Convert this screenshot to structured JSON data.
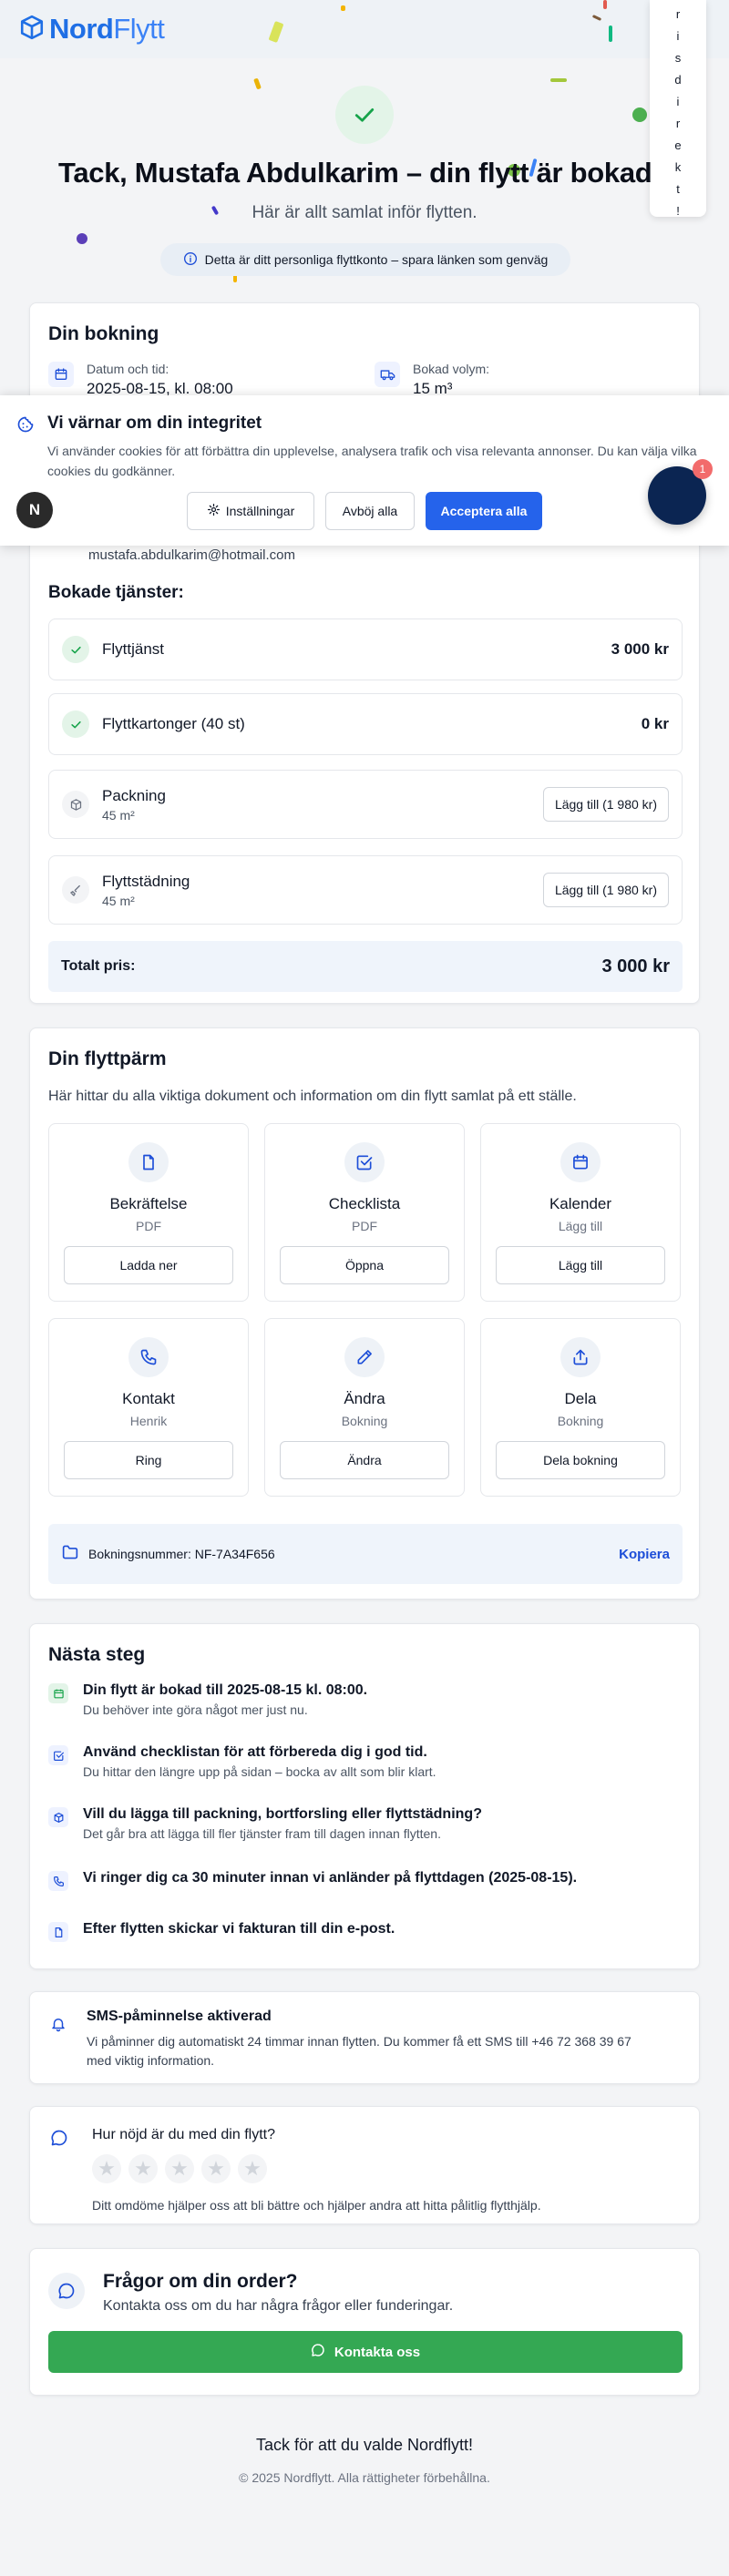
{
  "brand": {
    "name_a": "Nord",
    "name_b": "Flytt",
    "primary": "#1f6fe5",
    "success": "#16a34a",
    "blue_button": "#2563eb"
  },
  "side_tab": {
    "letters": [
      "r",
      "i",
      "s",
      "d",
      "i",
      "r",
      "e",
      "k",
      "t",
      "!"
    ]
  },
  "hero": {
    "title": "Tack, Mustafa Abdulkarim – din flytt är bokad",
    "subtitle": "Här är allt samlat inför flytten.",
    "info": "Detta är ditt personliga flyttkonto – spara länken som genväg"
  },
  "booking": {
    "title": "Din bokning",
    "date_label": "Datum och tid:",
    "date_value": "2025-08-15, kl. 08:00",
    "volume_label": "Bokad volym:",
    "volume_value": "15 m³",
    "email": "mustafa.abdulkarim@hotmail.com",
    "services_title": "Bokade tjänster:",
    "services": [
      {
        "name": "Flyttjänst",
        "sub": "",
        "price": "3 000 kr",
        "status": "booked"
      },
      {
        "name": "Flyttkartonger (40 st)",
        "sub": "",
        "price": "0 kr",
        "status": "booked"
      },
      {
        "name": "Packning",
        "sub": "45 m²",
        "action": "Lägg till (1 980 kr)",
        "status": "optional"
      },
      {
        "name": "Flyttstädning",
        "sub": "45 m²",
        "action": "Lägg till (1 980 kr)",
        "status": "optional"
      }
    ],
    "total_label": "Totalt pris:",
    "total_value": "3 000 kr"
  },
  "binder": {
    "title": "Din flyttpärm",
    "intro": "Här hittar du alla viktiga dokument och information om din flytt samlat på ett ställe.",
    "tiles": [
      {
        "title": "Bekräftelse",
        "sub": "PDF",
        "button": "Ladda ner",
        "icon": "file-icon"
      },
      {
        "title": "Checklista",
        "sub": "PDF",
        "button": "Öppna",
        "icon": "checkbox-icon"
      },
      {
        "title": "Kalender",
        "sub": "Lägg till",
        "button": "Lägg till",
        "icon": "calendar-icon"
      },
      {
        "title": "Kontakt",
        "sub": "Henrik",
        "button": "Ring",
        "icon": "phone-icon"
      },
      {
        "title": "Ändra",
        "sub": "Bokning",
        "button": "Ändra",
        "icon": "pencil-icon"
      },
      {
        "title": "Dela",
        "sub": "Bokning",
        "button": "Dela bokning",
        "icon": "share-icon"
      }
    ],
    "booking_number": "Bokningsnummer: NF-7A34F656",
    "copy": "Kopiera"
  },
  "next_steps": {
    "title": "Nästa steg",
    "steps": [
      {
        "title": "Din flytt är bokad till 2025-08-15 kl. 08:00.",
        "sub": "Du behöver inte göra något mer just nu."
      },
      {
        "title": "Använd checklistan för att förbereda dig i god tid.",
        "sub": "Du hittar den längre upp på sidan – bocka av allt som blir klart."
      },
      {
        "title": "Vill du lägga till packning, bortforsling eller flyttstädning?",
        "sub": "Det går bra att lägga till fler tjänster fram till dagen innan flytten."
      },
      {
        "title": "Vi ringer dig ca 30 minuter innan vi anländer på flyttdagen (2025-08-15).",
        "sub": ""
      },
      {
        "title": "Efter flytten skickar vi fakturan till din e-post.",
        "sub": ""
      }
    ]
  },
  "sms": {
    "title": "SMS-påminnelse aktiverad",
    "text_a": "Vi påminner dig automatiskt 24 timmar innan flytten. Du kommer få ett SMS till +46 72 368 39 67",
    "text_b": "med viktig information."
  },
  "rating": {
    "title": "Hur nöjd är du med din flytt?",
    "stars": 5,
    "selected": 0,
    "note": "Ditt omdöme hjälper oss att bli bättre och hjälper andra att hitta pålitlig flytthjälp."
  },
  "questions": {
    "title": "Frågor om din order?",
    "sub": "Kontakta oss om du har några frågor eller funderingar.",
    "button": "Kontakta oss"
  },
  "cookie": {
    "title": "Vi värnar om din integritet",
    "text": "Vi använder cookies för att förbättra din upplevelse, analysera trafik och visa relevanta annonser. Du kan välja vilka cookies du godkänner.",
    "settings": "Inställningar",
    "reject": "Avböj alla",
    "accept": "Acceptera alla"
  },
  "widgets": {
    "nextjs_badge": "N",
    "notification_count": "1"
  },
  "footer": {
    "thanks": "Tack för att du valde Nordflytt!",
    "copyright": "© 2025 Nordflytt. Alla rättigheter förbehållna."
  }
}
